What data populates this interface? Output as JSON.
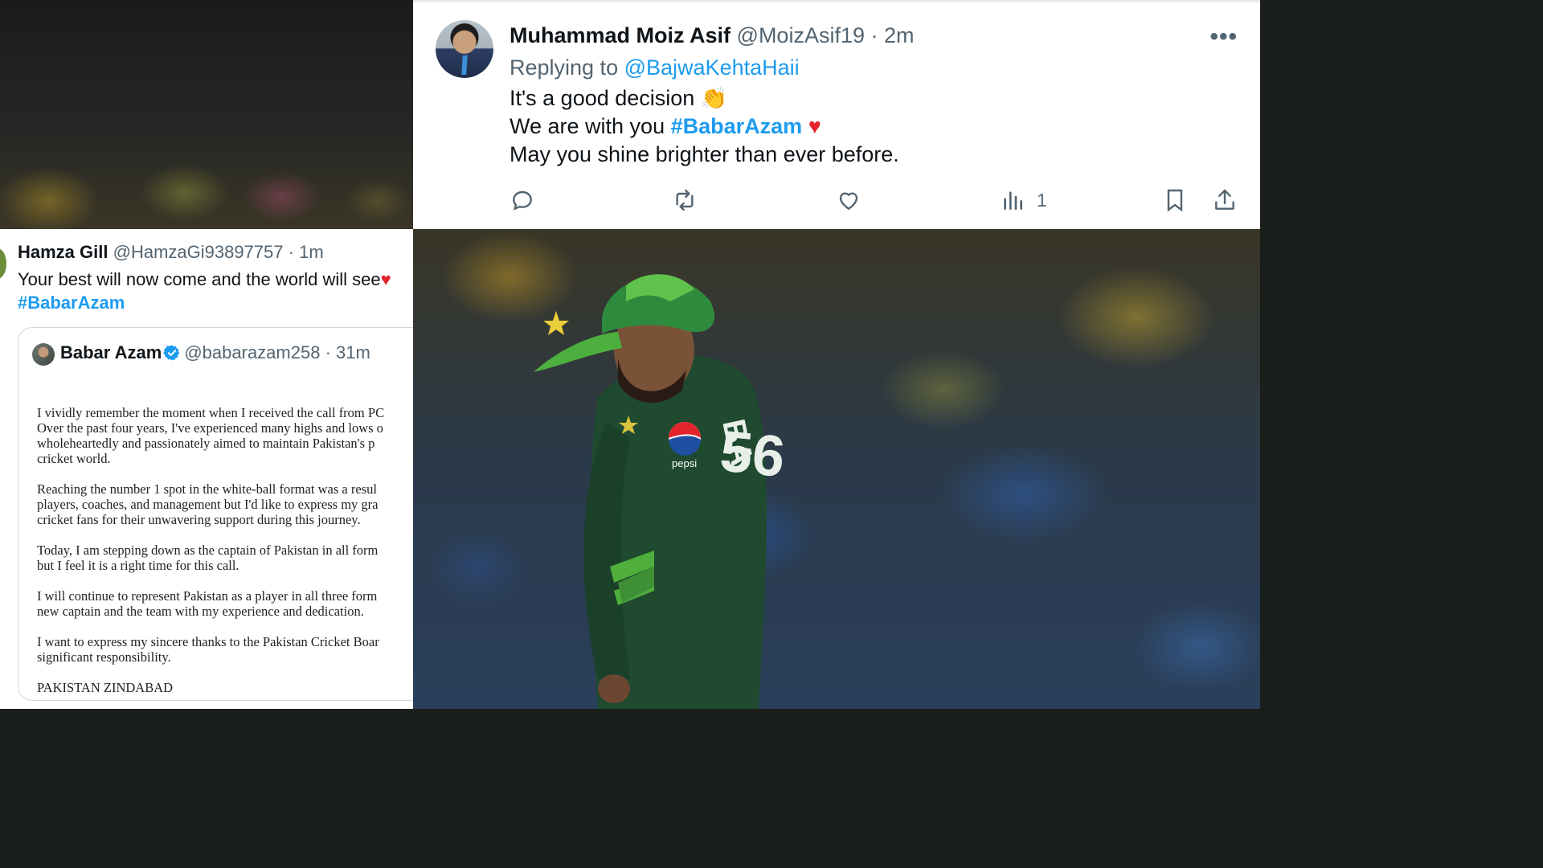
{
  "tweet_top": {
    "display_name": "Muhammad Moiz Asif",
    "handle": "@MoizAsif19",
    "time": "· 2m",
    "more": "•••",
    "replying_prefix": "Replying to",
    "replying_to": "@BajwaKehtaHaii",
    "line1": "It's a good decision",
    "line1_emoji": "👏",
    "line2": "We are with you",
    "line2_hashtag": "#BabarAzam",
    "line2_emoji": "♥",
    "line3": "May you shine brighter than ever before.",
    "views_count": "1",
    "icons": [
      "reply-icon",
      "retweet-icon",
      "like-icon",
      "views-icon",
      "bookmark-icon",
      "share-icon"
    ]
  },
  "tweet_bottom": {
    "display_name": "Hamza Gill",
    "handle": "@HamzaGi93897757",
    "time": "· 1m",
    "text": "Your best will now come and the world will see",
    "text_emoji": "♥",
    "hashtag": "#BabarAzam",
    "quote": {
      "display_name": "Babar Azam",
      "handle": "@babarazam258",
      "time": "· 31m",
      "paragraphs": [
        "I vividly remember the moment when I received the call from PC\nOver the past four years, I've experienced many highs and lows o\nwholeheartedly and passionately aimed to maintain Pakistan's p\ncricket world.",
        "Reaching the number 1 spot in the white-ball format was a resul\nplayers, coaches, and management but I'd like to express my gra\ncricket fans for their unwavering support during this journey.",
        "Today, I am stepping down as the captain of Pakistan in all form\nbut I feel it is a right time for this call.",
        "I will continue to represent Pakistan as a player in all three form\nnew captain and the team with my experience and dedication.",
        "I want to express my sincere thanks to the Pakistan Cricket Boar\nsignificant responsibility.",
        "PAKISTAN ZINDABAD"
      ]
    }
  },
  "photo": {
    "jersey_name": "BA",
    "jersey_number": "56",
    "sponsor": "pepsi",
    "colors": {
      "jersey": "#1f4a30",
      "cap": "#2e8b3e",
      "accent": "#5fc24a"
    }
  },
  "colors": {
    "link": "#1d9bf0",
    "grey_text": "#536471",
    "text": "#0f1419",
    "verified": "#1d9bf0"
  }
}
